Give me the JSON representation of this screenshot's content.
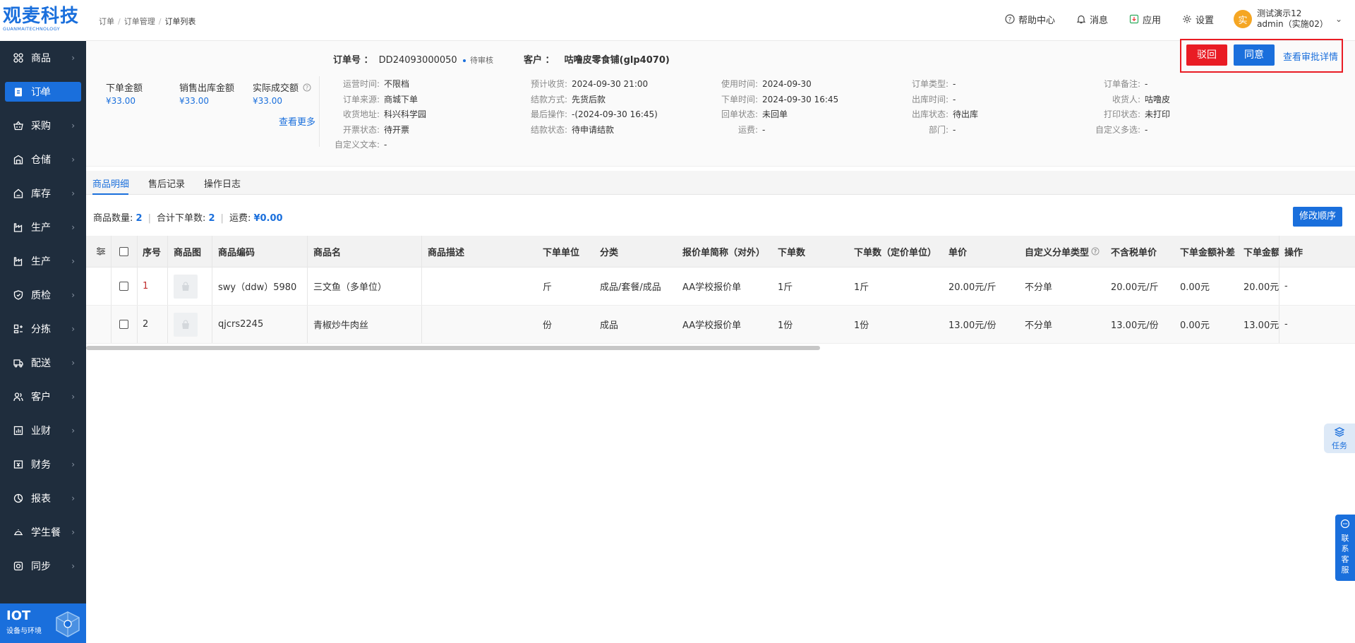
{
  "brand": {
    "name": "观麦科技",
    "sub": "GUANMAITECHNOLOGY"
  },
  "sidebar": {
    "items": [
      {
        "label": "商品",
        "icon": "grid-icon"
      },
      {
        "label": "订单",
        "icon": "clipboard-icon",
        "active": true
      },
      {
        "label": "采购",
        "icon": "basket-icon"
      },
      {
        "label": "仓储",
        "icon": "warehouse-icon"
      },
      {
        "label": "库存",
        "icon": "house-icon"
      },
      {
        "label": "生产",
        "icon": "factory-icon"
      },
      {
        "label": "生产",
        "icon": "factory-icon"
      },
      {
        "label": "质检",
        "icon": "shield-icon"
      },
      {
        "label": "分拣",
        "icon": "sort-icon"
      },
      {
        "label": "配送",
        "icon": "truck-icon"
      },
      {
        "label": "客户",
        "icon": "users-icon"
      },
      {
        "label": "业财",
        "icon": "bar-chart-icon"
      },
      {
        "label": "财务",
        "icon": "wallet-icon"
      },
      {
        "label": "报表",
        "icon": "pie-icon"
      },
      {
        "label": "学生餐",
        "icon": "dish-icon"
      },
      {
        "label": "同步",
        "icon": "sync-icon"
      }
    ],
    "iot": {
      "title": "IOT",
      "sub": "设备与环境"
    }
  },
  "header": {
    "breadcrumb": [
      "订单",
      "订单管理",
      "订单列表"
    ],
    "help": "帮助中心",
    "messages": "消息",
    "apps": "应用",
    "settings": "设置",
    "avatar_char": "实",
    "user_name": "测试演示12",
    "user_account": "admin（实施02）"
  },
  "order": {
    "no_label": "订单号 ：",
    "no": "DD24093000050",
    "status": "待审核",
    "customer_label": "客户 ：",
    "customer": "咕噜皮零食铺(glp4070)",
    "amounts": [
      {
        "label": "下单金额",
        "value": "¥33.00"
      },
      {
        "label": "销售出库金额",
        "value": "¥33.00"
      },
      {
        "label": "实际成交额",
        "value": "¥33.00"
      }
    ],
    "see_more": "查看更多",
    "col1": [
      {
        "k": "运营时间:",
        "v": "不限档"
      },
      {
        "k": "订单来源:",
        "v": "商城下单"
      },
      {
        "k": "收货地址:",
        "v": "科兴科学园"
      },
      {
        "k": "开票状态:",
        "v": "待开票"
      },
      {
        "k": "自定义文本:",
        "v": "-"
      }
    ],
    "col2": [
      {
        "k": "预计收货:",
        "v": "2024-09-30 21:00"
      },
      {
        "k": "结款方式:",
        "v": "先货后款"
      },
      {
        "k": "最后操作:",
        "v": "-(2024-09-30 16:45)"
      },
      {
        "k": "结款状态:",
        "v": "待申请结款"
      }
    ],
    "col3": [
      {
        "k": "使用时间:",
        "v": "2024-09-30"
      },
      {
        "k": "下单时间:",
        "v": "2024-09-30 16:45"
      },
      {
        "k": "回单状态:",
        "v": "未回单"
      },
      {
        "k": "运费:",
        "v": "-"
      }
    ],
    "col4": [
      {
        "k": "订单类型:",
        "v": "-"
      },
      {
        "k": "出库时间:",
        "v": "-"
      },
      {
        "k": "出库状态:",
        "v": "待出库"
      },
      {
        "k": "部门:",
        "v": "-"
      }
    ],
    "col5": [
      {
        "k": "订单备注:",
        "v": "-"
      },
      {
        "k": "收货人:",
        "v": "咕噜皮"
      },
      {
        "k": "打印状态:",
        "v": "未打印"
      },
      {
        "k": "自定义多选:",
        "v": "-"
      }
    ]
  },
  "actions": {
    "reject": "驳回",
    "approve": "同意",
    "detail": "查看审批详情"
  },
  "tabs": [
    "商品明细",
    "售后记录",
    "操作日志"
  ],
  "stats": {
    "count_label": "商品数量:",
    "count": "2",
    "total_label": "合计下单数:",
    "total": "2",
    "freight_label": "运费:",
    "freight": "¥0.00"
  },
  "modify_order": "修改顺序",
  "table": {
    "headers": [
      "序号",
      "商品图",
      "商品编码",
      "商品名",
      "商品描述",
      "下单单位",
      "分类",
      "报价单简称（对外）",
      "下单数",
      "下单数（定价单位）",
      "单价",
      "自定义分单类型",
      "不含税单价",
      "下单金额补差",
      "下单金额",
      "操作"
    ],
    "rows": [
      [
        "1",
        "",
        "swy（ddw）5980",
        "三文鱼（多单位）",
        "",
        "斤",
        "成品/套餐/成品",
        "AA学校报价单",
        "1斤",
        "1斤",
        "20.00元/斤",
        "不分单",
        "20.00元/斤",
        "0.00元",
        "20.00元",
        "-"
      ],
      [
        "2",
        "",
        "qjcrs2245",
        "青椒炒牛肉丝",
        "",
        "份",
        "成品",
        "AA学校报价单",
        "1份",
        "1份",
        "13.00元/份",
        "不分单",
        "13.00元/份",
        "0.00元",
        "13.00元",
        "-"
      ]
    ]
  },
  "floats": {
    "task": "任务",
    "cs": "联系客服"
  },
  "colors": {
    "primary": "#1a6fdc",
    "danger": "#e91c24",
    "sidebar": "#1f2d3d"
  }
}
